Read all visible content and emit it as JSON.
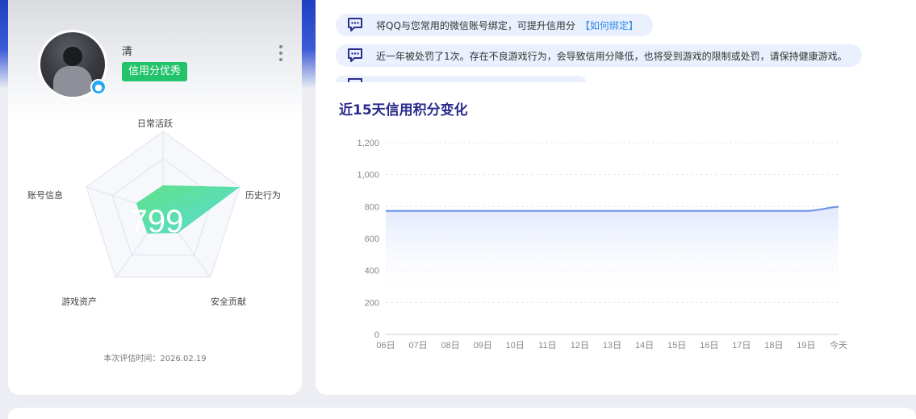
{
  "profile": {
    "name": "清",
    "credit_level": "信用分优秀",
    "score": "799",
    "eval_time": "本次评估时间：2026.02.19"
  },
  "radar": {
    "axes": [
      "日常活跃",
      "历史行为",
      "安全贡献",
      "游戏资产",
      "账号信息"
    ],
    "values": [
      0.33,
      1.0,
      0.32,
      0.33,
      0.35
    ],
    "fill_color_start": "#54e07f",
    "fill_color_end": "#49d8d2"
  },
  "notices": [
    {
      "text": "将QQ与您常用的微信账号绑定，可提升信用分",
      "link": "【如何绑定】"
    },
    {
      "text": "近一年被处罚了1次。存在不良游戏行为，会导致信用分降低，也将受到游戏的限制或处罚，请保持健康游戏。",
      "link": ""
    }
  ],
  "chart_title": "近15天信用积分变化",
  "chart_data": {
    "type": "area",
    "title": "近15天信用积分变化",
    "categories": [
      "06日",
      "07日",
      "08日",
      "09日",
      "10日",
      "11日",
      "12日",
      "13日",
      "14日",
      "15日",
      "16日",
      "17日",
      "18日",
      "19日",
      "今天"
    ],
    "values": [
      773,
      773,
      773,
      773,
      773,
      773,
      773,
      773,
      773,
      773,
      773,
      773,
      773,
      773,
      799
    ],
    "ylim": [
      0,
      1200
    ],
    "yticks": [
      "0",
      "200",
      "400",
      "600",
      "800",
      "1,000",
      "1,200"
    ],
    "grid": true,
    "line_color": "#6a8fe8",
    "fill_color": "#dde6fd"
  }
}
